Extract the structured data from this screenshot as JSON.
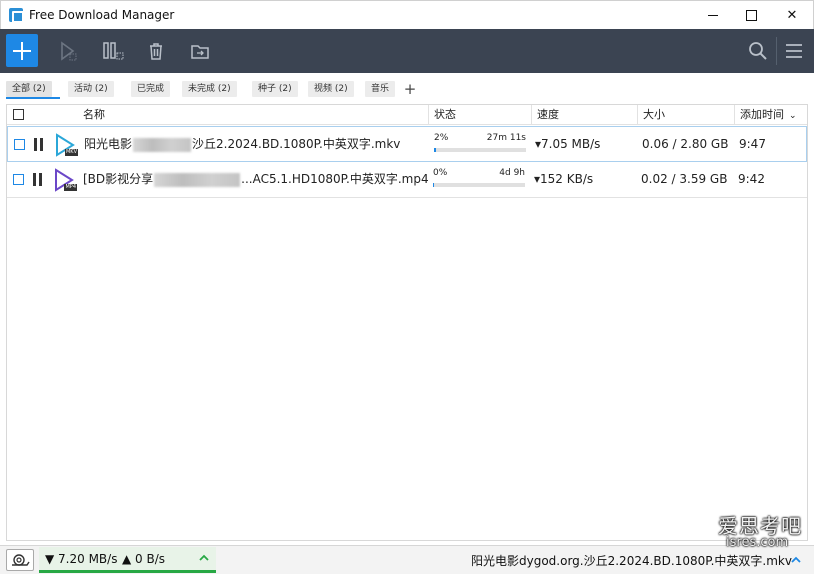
{
  "window": {
    "title": "Free Download Manager"
  },
  "toolbar": {
    "icons": [
      "plus-icon",
      "play-icon",
      "pause-icon",
      "trash-icon",
      "move-folder-icon",
      "search-icon",
      "hamburger-menu-icon"
    ]
  },
  "filters": [
    {
      "label": "全部 (2)",
      "active": true
    },
    {
      "label": "活动 (2)",
      "active": false
    },
    {
      "label": "已完成",
      "active": false
    },
    {
      "label": "未完成 (2)",
      "active": false
    },
    {
      "label": "种子 (2)",
      "active": false
    },
    {
      "label": "视频 (2)",
      "active": false
    },
    {
      "label": "音乐",
      "active": false
    }
  ],
  "filter_add": "+",
  "columns": {
    "name": "名称",
    "status": "状态",
    "speed": "速度",
    "size": "大小",
    "added": "添加时间",
    "sort_arrow": "⌄"
  },
  "downloads": [
    {
      "name_prefix": "阳光电影",
      "name_suffix": "沙丘2.2024.BD.1080P.中英双字.mkv",
      "type_badge": "MKV",
      "type_color": "#2ba7d8",
      "percent_label": "2%",
      "progress": 0.02,
      "eta": "27m 11s",
      "speed": "▾7.05 MB/s",
      "size": "0.06 / 2.80 GB",
      "added": "9:47"
    },
    {
      "name_prefix": "[BD影视分享",
      "name_suffix": "...AC5.1.HD1080P.中英双字.mp4",
      "type_badge": "MP4",
      "type_color": "#6b47c8",
      "percent_label": "0%",
      "progress": 0.0,
      "eta": "4d 9h",
      "speed": "▾152 KB/s",
      "size": "0.02 / 3.59 GB",
      "added": "9:42"
    }
  ],
  "statusbar": {
    "down": "▼ 7.20 MB/s",
    "up": "▲ 0 B/s",
    "current_file": "阳光电影dygod.org.沙丘2.2024.BD.1080P.中英双字.mkv",
    "accent": "#27a844"
  },
  "watermark": {
    "line1": "爱思考吧",
    "line2": "isres.com"
  }
}
